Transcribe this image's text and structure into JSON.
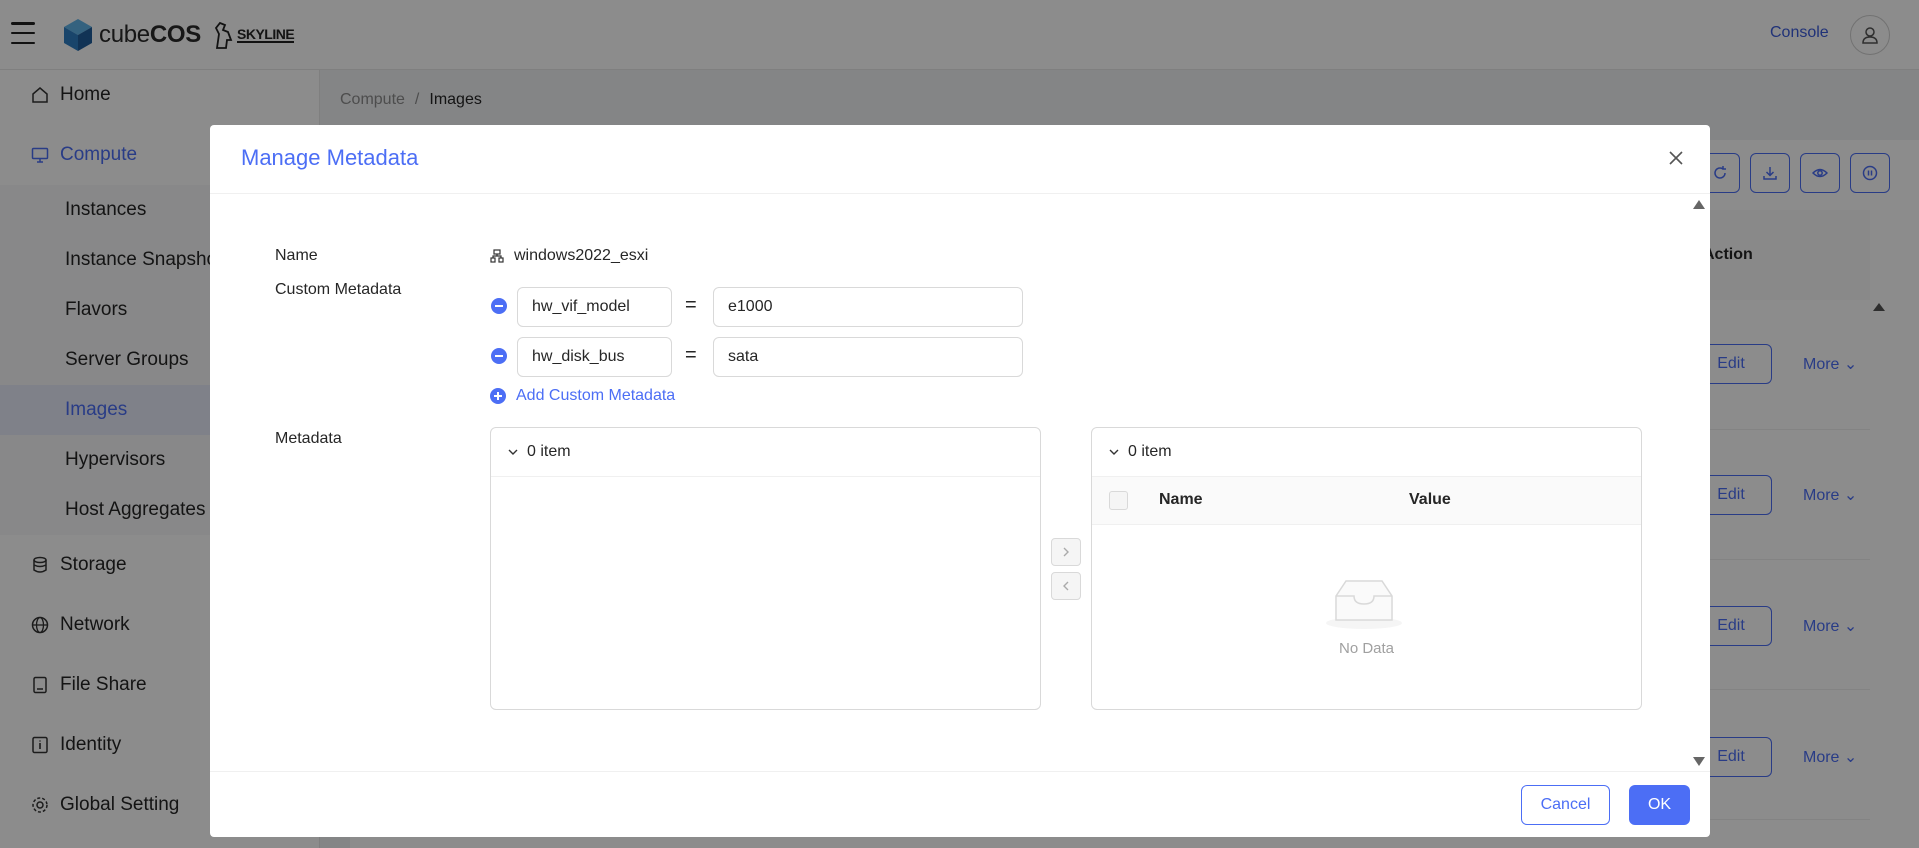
{
  "header": {
    "logo_text_light": "cube",
    "logo_text_bold": "COS",
    "partner_logo": "SKYLINE",
    "console_link": "Console"
  },
  "sidebar": {
    "items": [
      {
        "label": "Home",
        "icon": "home-icon"
      },
      {
        "label": "Compute",
        "icon": "monitor-icon",
        "active": true
      },
      {
        "label": "Storage",
        "icon": "database-icon"
      },
      {
        "label": "Network",
        "icon": "globe-icon"
      },
      {
        "label": "File Share",
        "icon": "file-icon"
      },
      {
        "label": "Identity",
        "icon": "info-icon"
      },
      {
        "label": "Global Setting",
        "icon": "gear-icon"
      }
    ],
    "compute_subitems": [
      {
        "label": "Instances"
      },
      {
        "label": "Instance Snapshots"
      },
      {
        "label": "Flavors"
      },
      {
        "label": "Server Groups"
      },
      {
        "label": "Images",
        "selected": true
      },
      {
        "label": "Hypervisors"
      },
      {
        "label": "Host Aggregates"
      }
    ]
  },
  "breadcrumb": {
    "parent": "Compute",
    "separator": "/",
    "current": "Images"
  },
  "background_table": {
    "action_header": "Action",
    "edit_label": "Edit",
    "more_label": "More"
  },
  "modal": {
    "title": "Manage Metadata",
    "name_label": "Name",
    "name_value": "windows2022_esxi",
    "custom_metadata_label": "Custom Metadata",
    "custom_metadata": [
      {
        "key": "hw_vif_model",
        "value": "e1000"
      },
      {
        "key": "hw_disk_bus",
        "value": "sata"
      }
    ],
    "equals": "=",
    "add_custom_label": "Add Custom Metadata",
    "metadata_label": "Metadata",
    "left_panel": {
      "count_label": "0 item"
    },
    "right_panel": {
      "count_label": "0 item",
      "col_name": "Name",
      "col_value": "Value",
      "empty_text": "No Data"
    },
    "cancel_label": "Cancel",
    "ok_label": "OK"
  },
  "colors": {
    "accent": "#4c6ef5",
    "selected_bg": "#e7ebfa",
    "cube_blue": "#3a8fd6"
  }
}
